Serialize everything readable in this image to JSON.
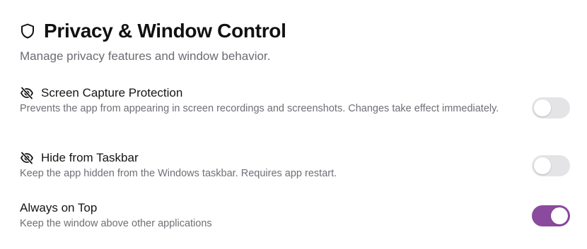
{
  "header": {
    "icon": "shield-icon",
    "title": "Privacy & Window Control",
    "subtitle": "Manage privacy features and window behavior."
  },
  "settings": [
    {
      "icon": "eye-off-icon",
      "label": "Screen Capture Protection",
      "description": "Prevents the app from appearing in screen recordings and screenshots. Changes take effect immediately.",
      "enabled": false
    },
    {
      "icon": "eye-off-icon",
      "label": "Hide from Taskbar",
      "description": "Keep the app hidden from the Windows taskbar. Requires app restart.",
      "enabled": false
    },
    {
      "icon": "",
      "label": "Always on Top",
      "description": "Keep the window above other applications",
      "enabled": true
    }
  ],
  "colors": {
    "toggle_on": "#8a4a9e",
    "toggle_off": "#e4e4e7"
  }
}
